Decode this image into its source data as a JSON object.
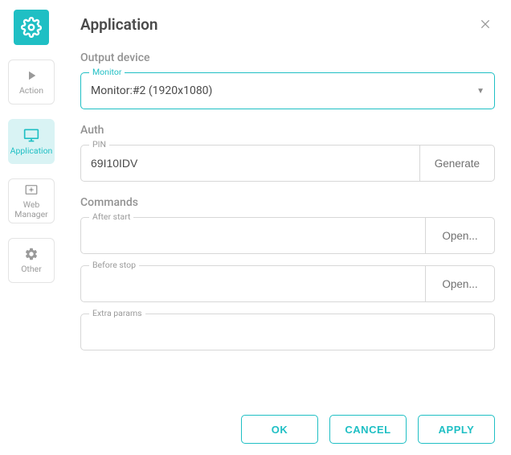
{
  "header": {
    "title": "Application"
  },
  "sidebar": {
    "items": [
      {
        "label": "Action",
        "icon": "play-icon"
      },
      {
        "label": "Application",
        "icon": "monitor-icon"
      },
      {
        "label": "Web Manager",
        "icon": "web-icon"
      },
      {
        "label": "Other",
        "icon": "gear-icon"
      }
    ]
  },
  "sections": {
    "output": {
      "label": "Output device",
      "monitor_legend": "Monitor",
      "monitor_value": "Monitor:#2 (1920x1080)"
    },
    "auth": {
      "label": "Auth",
      "pin_legend": "PIN",
      "pin_value": "69I10IDV",
      "generate_label": "Generate"
    },
    "commands": {
      "label": "Commands",
      "after_start_legend": "After start",
      "after_start_value": "",
      "before_stop_legend": "Before stop",
      "before_stop_value": "",
      "extra_legend": "Extra params",
      "extra_value": "",
      "open_label": "Open..."
    }
  },
  "footer": {
    "ok": "OK",
    "cancel": "CANCEL",
    "apply": "APPLY"
  },
  "colors": {
    "accent": "#1fbfc4"
  }
}
